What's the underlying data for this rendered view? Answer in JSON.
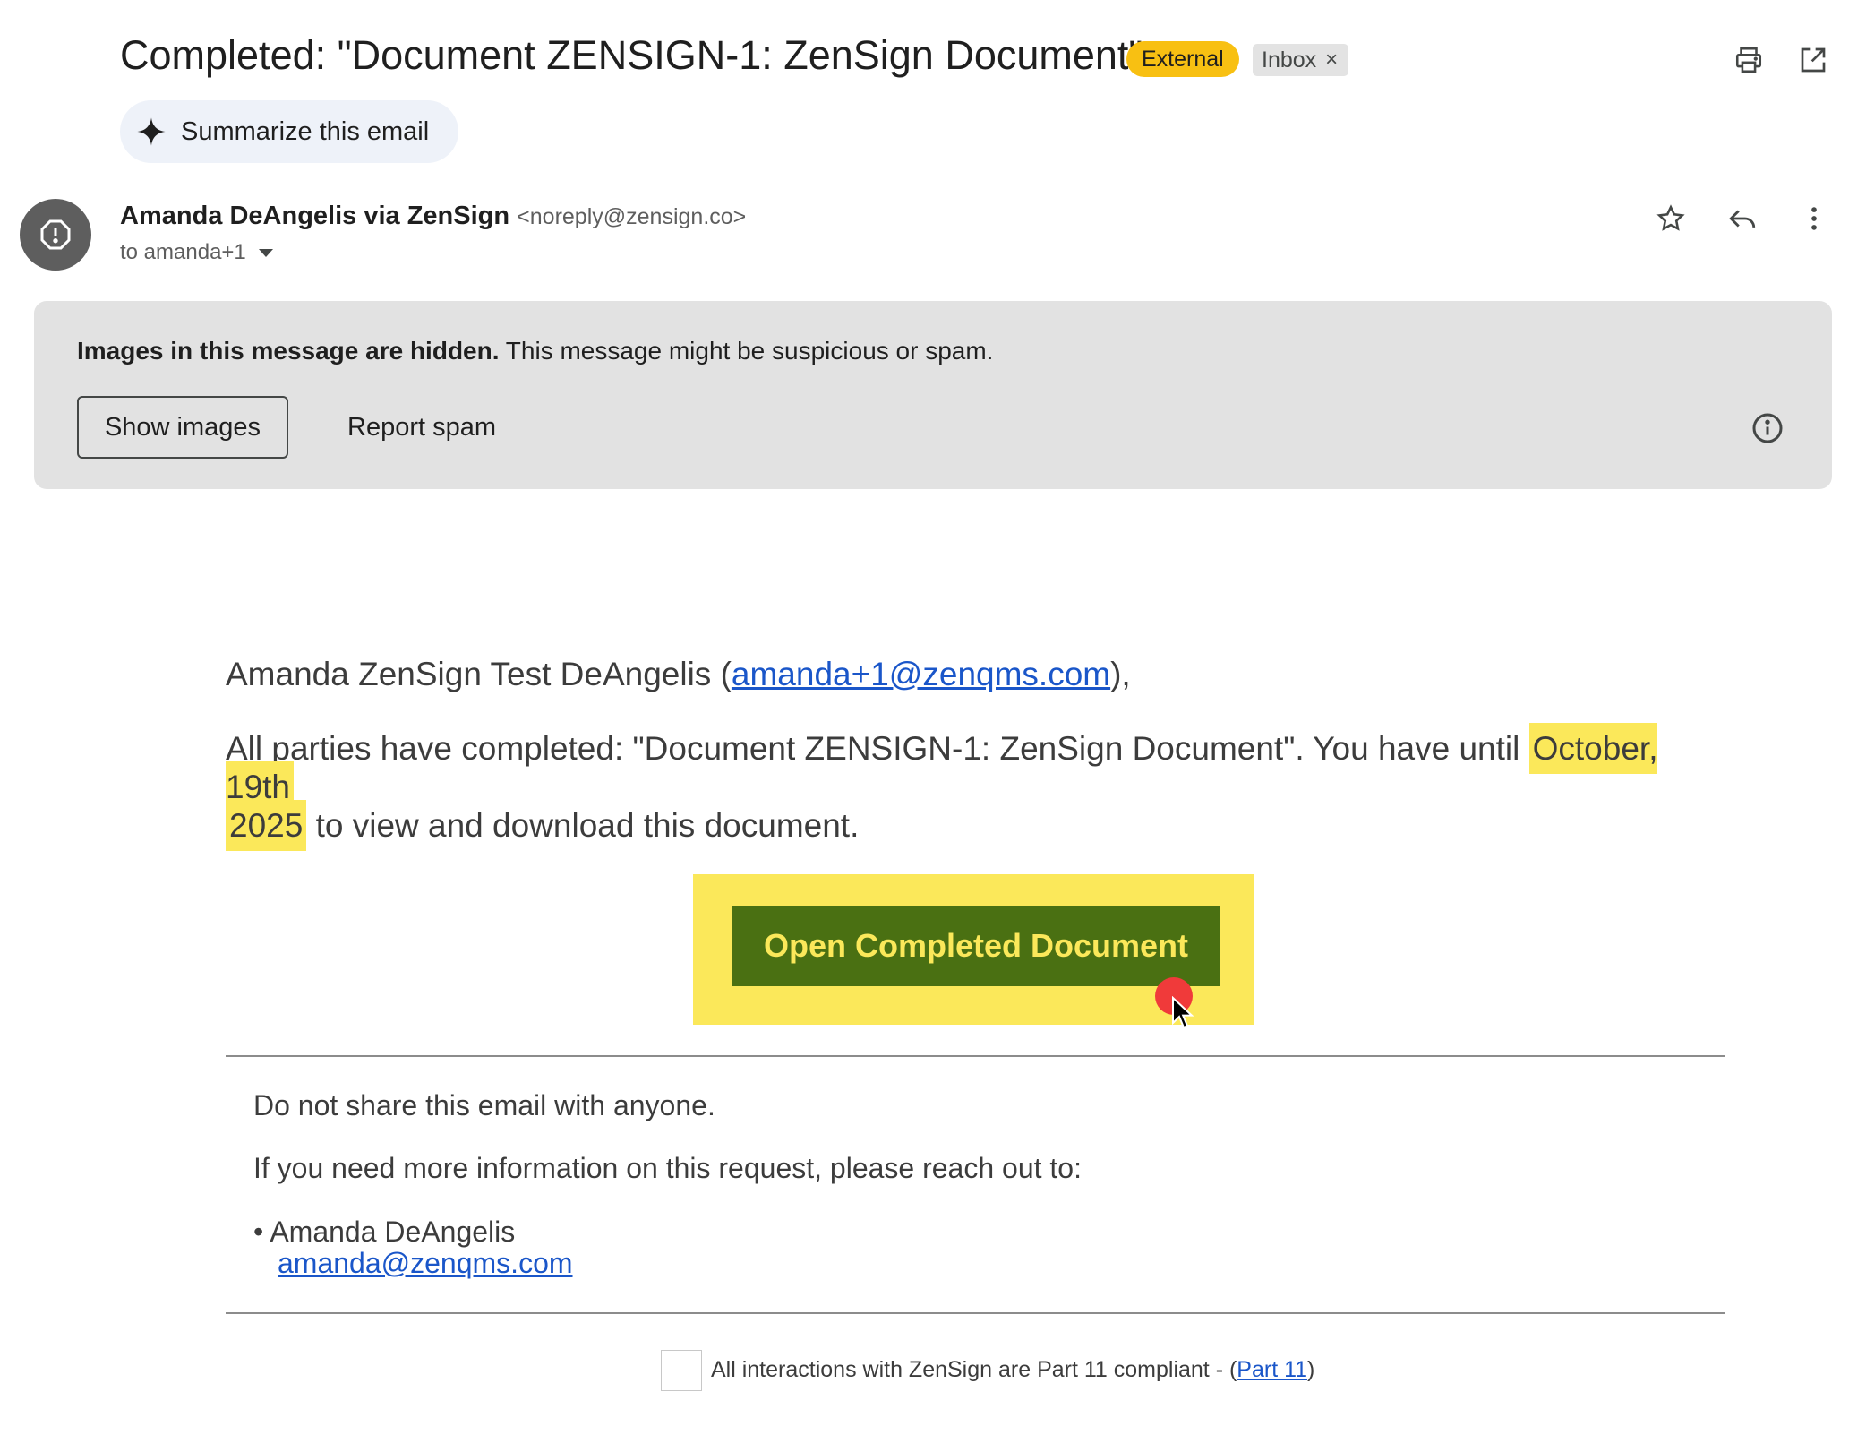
{
  "header": {
    "subject": "Completed: \"Document ZENSIGN-1: ZenSign Document\"",
    "label_external": "External",
    "label_inbox": "Inbox",
    "label_remove_glyph": "×",
    "print_icon": "print-icon",
    "popout_icon": "open-in-new-window-icon"
  },
  "summarize": {
    "label": "Summarize this email",
    "icon": "sparkle-icon"
  },
  "sender": {
    "name": "Amanda DeAngelis via ZenSign",
    "email": "<noreply@zensign.co>",
    "to": "to amanda+1",
    "avatar_icon": "warning-octagon-icon"
  },
  "banner": {
    "bold_text": "Images in this message are hidden.",
    "text": " This message might be suspicious or spam.",
    "show_images": "Show images",
    "report_spam": "Report spam"
  },
  "body": {
    "greeting_prefix": "Amanda ZenSign Test DeAngelis (",
    "greeting_link": "amanda+1@zenqms.com",
    "greeting_suffix": "),",
    "para_prefix": "All parties have completed: \"Document ZENSIGN-1: ZenSign Document\". You have until ",
    "para_highlight_1": "October, 19th",
    "para_highlight_2": "2025",
    "para_suffix": " to view and download this document.",
    "cta": "Open Completed Document",
    "no_share": "Do not share this email with anyone.",
    "more_info": "If you need more information on this request, please reach out to:",
    "contact_name": "• Amanda DeAngelis",
    "contact_email": "amanda@zenqms.com",
    "footer_text": "All interactions with ZenSign are Part 11 compliant - (",
    "footer_link": "Part 11",
    "footer_close": ")"
  },
  "colors": {
    "external_chip": "#f8c012",
    "highlight": "#fbe85a",
    "cta_background": "#4a7012",
    "link": "#1a56c9",
    "banner": "#e2e2e2"
  }
}
